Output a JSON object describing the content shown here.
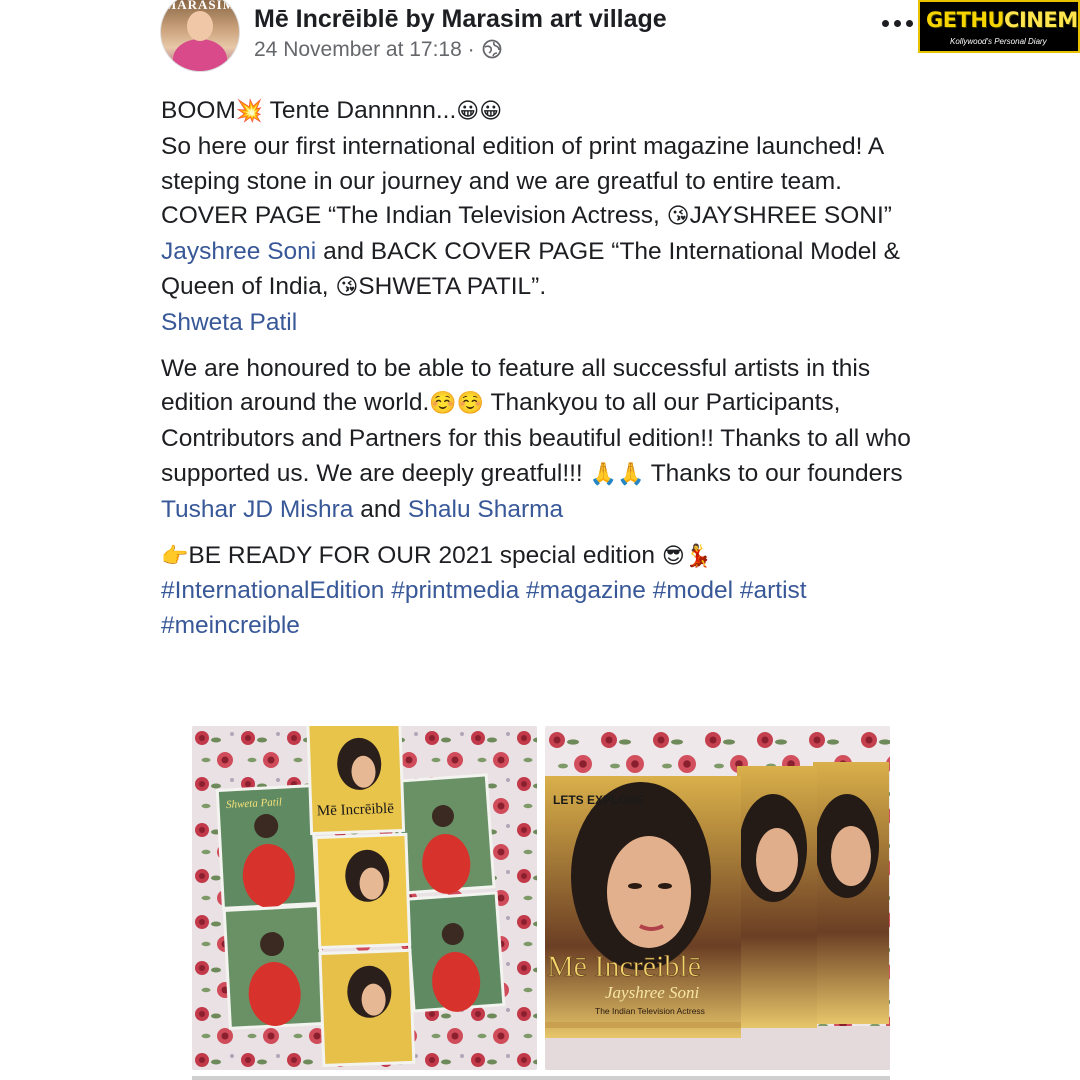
{
  "post": {
    "page_name": "Mē Incrēiblē by Marasim art village",
    "timestamp": "24 November at 17:18",
    "separator": "·",
    "avatar_masthead": "MARASIM",
    "privacy_icon": "globe-icon",
    "more_icon": "more-horizontal-icon"
  },
  "watermark": {
    "main_left": "GETHU",
    "main_right": "CINEMA",
    "sub": "Kollywood's Personal Diary"
  },
  "text": {
    "p1_boom": "BOOM",
    "p1_tente": " Tente Dannnnn...",
    "p1_line2": "So here our first international edition of print magazine launched! A steping stone in our journey and we are greatful to entire team.",
    "p1_cover_a": "COVER PAGE “The Indian Television Actress, ",
    "p1_cover_b": "JAYSHREE SONI” ",
    "p1_link_jayshree": "Jayshree Soni",
    "p1_cover_c": " and BACK COVER PAGE “The International Model & Queen of India, ",
    "p1_cover_d": "SHWETA PATIL”.",
    "p1_link_shweta": "Shweta Patil",
    "p2_a": "We are honoured to be able to feature all successful artists in this edition around the world.",
    "p2_b": " Thankyou to all our Participants, Contributors and Partners for this beautiful edition!! Thanks to all who supported us. We are deeply greatful!!! ",
    "p2_c": " Thanks to our founders ",
    "p2_link_tushar": "Tushar JD Mishra",
    "p2_and": " and ",
    "p2_link_shalu": "Shalu Sharma",
    "p3_a": "BE READY FOR OUR 2021 special edition ",
    "hashtags": [
      "#InternationalEdition",
      "#printmedia",
      "#magazine",
      "#model",
      "#artist",
      "#meincreible"
    ]
  },
  "emoji": {
    "boom": "💥",
    "grin": "😀😀",
    "kiss": "😘",
    "blush": "☺️☺️",
    "pray": "🙏🙏",
    "point": "👉",
    "cool_dance": "😎💃"
  },
  "photos": {
    "left_cover_name": "Shweta Patil",
    "left_mag_title": "Mē Incrēiblē",
    "right_explore": "LETS EXPLORE",
    "right_mag_title": "Mē Incrēiblē",
    "right_cover_name": "Jayshree Soni",
    "right_subtitle": "The Indian Television Actress"
  }
}
